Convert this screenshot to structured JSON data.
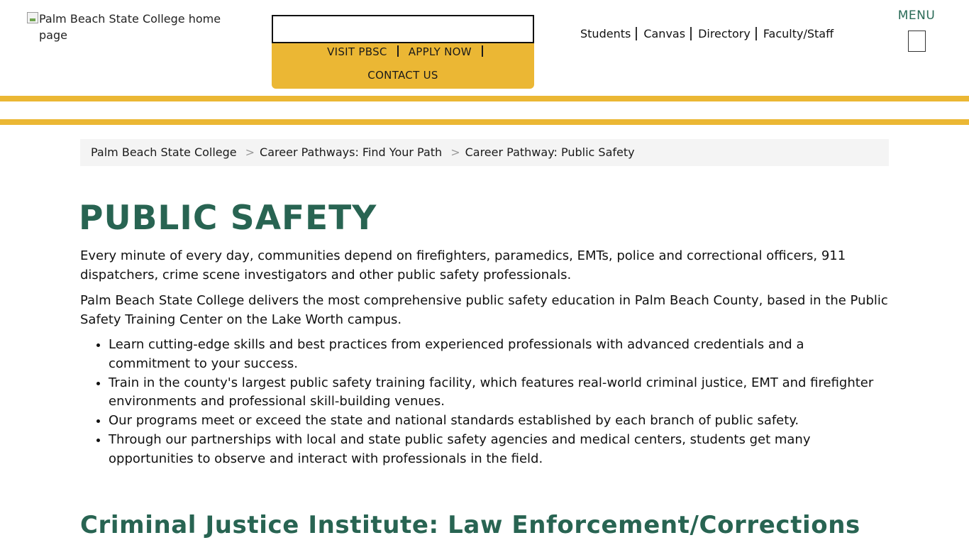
{
  "header": {
    "logo_alt": "Palm Beach State College home page",
    "search": {
      "value": "",
      "placeholder": ""
    },
    "cta": {
      "visit": "VISIT PBSC",
      "apply": "APPLY NOW",
      "contact": "CONTACT US"
    },
    "quick_links": {
      "students": "Students",
      "canvas": "Canvas",
      "directory": "Directory",
      "faculty_staff": "Faculty/Staff"
    },
    "menu_label": "MENU"
  },
  "breadcrumb": {
    "separator": ">",
    "items": [
      "Palm Beach State College",
      "Career Pathways: Find Your Path",
      "Career Pathway: Public Safety"
    ]
  },
  "main": {
    "title": "PUBLIC SAFETY",
    "paragraphs": [
      "Every minute of every day, communities depend on firefighters, paramedics, EMTs, police and correctional officers, 911 dispatchers, crime scene investigators and other public safety professionals.",
      "Palm Beach State College delivers the most comprehensive public safety education in Palm Beach County, based in the Public Safety Training Center on the Lake Worth campus."
    ],
    "bullets": [
      "Learn cutting-edge skills and best practices from experienced professionals with advanced credentials and a commitment to your success.",
      "Train in the county's largest public safety training facility, which features real-world criminal justice, EMT and firefighter environments and professional skill-building venues.",
      "Our programs meet or exceed the state and national standards established by each branch of public safety.",
      "Through our partnerships with local and state public safety agencies and medical centers, students get many opportunities to observe and interact with professionals in the field."
    ],
    "section_heading": "Criminal Justice Institute: Law Enforcement/Corrections"
  },
  "colors": {
    "brand_green": "#286452",
    "brand_gold": "#ebb734",
    "breadcrumb_bg": "#f4f4f4"
  }
}
